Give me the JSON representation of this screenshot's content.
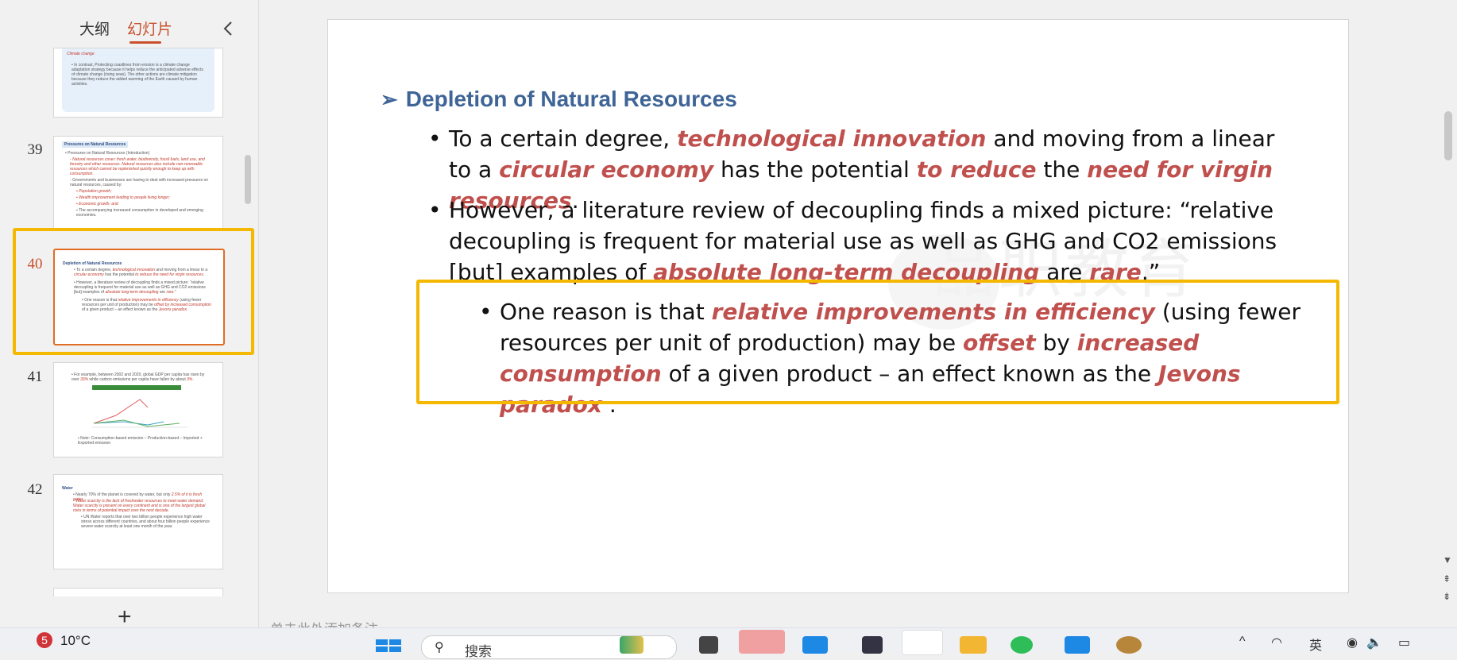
{
  "left_panel": {
    "tab_outline": "大纲",
    "tab_slides": "幻灯片",
    "collapse_icon": "chevron-left-icon",
    "add_slide_label": "+",
    "slides": [
      {
        "number": "39",
        "title": "Pressures on Natural Resources"
      },
      {
        "number": "40",
        "title": "Depletion of Natural Resources"
      },
      {
        "number": "41",
        "title": ""
      },
      {
        "number": "42",
        "title": "Water"
      }
    ]
  },
  "slide": {
    "heading": "Depletion of Natural Resources",
    "watermark": "品职教育",
    "bullet1": {
      "t1": "To a certain degree, ",
      "e1": "technological innovation",
      "t2": " and moving from a linear to a ",
      "e2": "circular economy",
      "t3": " has the potential ",
      "e3": "to reduce",
      "t4": " the ",
      "e4": "need for virgin resources",
      "t5": "."
    },
    "bullet2": {
      "t1": "However, a literature review of decoupling finds a mixed picture: “relative decoupling is frequent for material use as well as GHG and CO2 emissions [but] examples of ",
      "e1": "absolute long-term decoupling",
      "t2": " are ",
      "e2": "rare",
      "t3": ".”"
    },
    "bullet3": {
      "t1": "One reason is that ",
      "e1": "relative improvements in efficiency",
      "t2": " (using fewer resources per unit of production) may be ",
      "e2": "offset",
      "t3": " by ",
      "e3": "increased consumption",
      "t4": " of a given product – an effect known as the ",
      "e4": "Jevons paradox",
      "t5": " ."
    }
  },
  "notes_hint": "单击此处添加备注",
  "taskbar": {
    "weather_badge": "5",
    "weather_temp": "10°C",
    "search_label": "搜索",
    "tray_lang": "英"
  },
  "colors": {
    "accent_orange": "#c8502c",
    "highlight_yellow": "#f5b800",
    "heading_blue": "#3f6597",
    "emphasis_red": "#c0504d"
  }
}
